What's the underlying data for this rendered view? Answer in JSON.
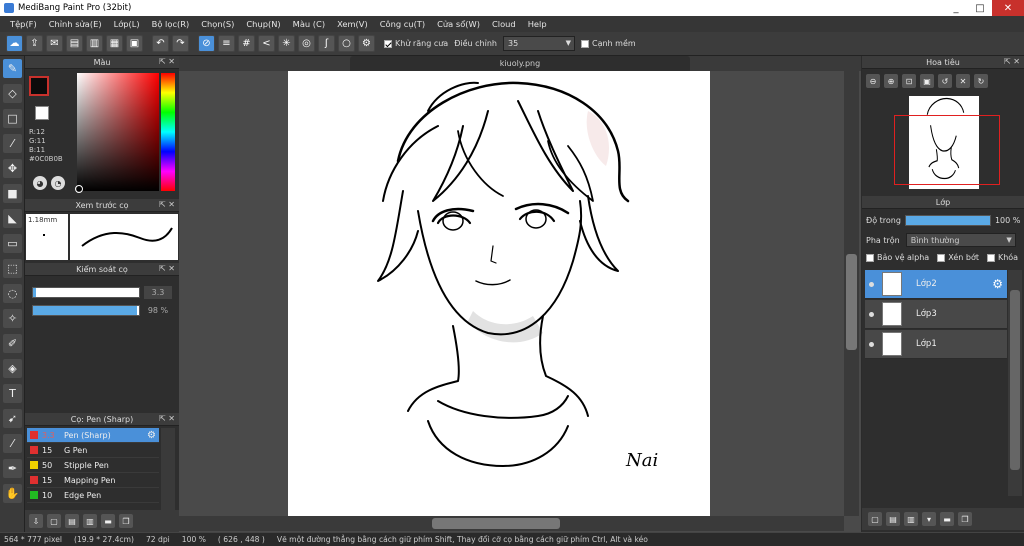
{
  "window": {
    "title": "MediBang Paint Pro (32bit)",
    "minimize": "_",
    "maximize": "□",
    "close": "✕"
  },
  "menu": [
    "Tệp(F)",
    "Chỉnh sửa(E)",
    "Lớp(L)",
    "Bộ lọc(R)",
    "Chọn(S)",
    "Chụp(N)",
    "Màu (C)",
    "Xem(V)",
    "Công cụ(T)",
    "Cửa sổ(W)",
    "Cloud",
    "Help"
  ],
  "toolbar": {
    "antialias_label": "Khử răng cưa",
    "adjust_label": "Điều chỉnh",
    "adjust_value": "35",
    "sharp_label": "Cạnh mềm"
  },
  "color_panel": {
    "title": "Màu",
    "r": "R:12",
    "g": "G:11",
    "b": "B:11",
    "hex": "#0C0B0B",
    "main_color": "#0C0B0B"
  },
  "brush_preview": {
    "title": "Xem trước cọ",
    "size": "1.18mm"
  },
  "brush_control": {
    "title": "Kiểm soát cọ",
    "size_value": "3.3",
    "size_fraction": 1.0,
    "opacity_value": "98 %",
    "opacity_fraction": 0.98
  },
  "brush_list": {
    "title": "Cọ: Pen (Sharp)",
    "items": [
      {
        "size": "3.3",
        "name": "Pen (Sharp)",
        "color": "#e03030"
      },
      {
        "size": "15",
        "name": "G Pen",
        "color": "#e03030"
      },
      {
        "size": "50",
        "name": "Stipple Pen",
        "color": "#f0d000"
      },
      {
        "size": "15",
        "name": "Mapping Pen",
        "color": "#e03030"
      },
      {
        "size": "10",
        "name": "Edge Pen",
        "color": "#22bb22"
      }
    ]
  },
  "canvas": {
    "tab": "kiuoly.png",
    "signature": "Nai"
  },
  "navigator": {
    "title": "Hoa tiêu"
  },
  "layers_panel": {
    "title": "Lớp",
    "opacity_label": "Độ trong",
    "opacity_value": "100 %",
    "opacity_fraction": 1.0,
    "blend_label": "Pha trộn",
    "blend_value": "Bình thường",
    "protect_alpha": "Bảo vệ alpha",
    "clipping": "Xén bớt",
    "lock": "Khóa",
    "layers": [
      {
        "name": "Lớp2",
        "selected": true
      },
      {
        "name": "Lớp3",
        "selected": false
      },
      {
        "name": "Lớp1",
        "selected": false
      }
    ]
  },
  "status": {
    "pixel": "564 * 777 pixel",
    "size_cm": "(19.9 * 27.4cm)",
    "dpi": "72 dpi",
    "zoom": "100 %",
    "coords": "( 626 , 448 )",
    "hint": "Vẽ một đường thẳng bằng cách giữ phím Shift, Thay đổi cỡ cọ bằng cách giữ phím Ctrl, Alt và kéo"
  }
}
